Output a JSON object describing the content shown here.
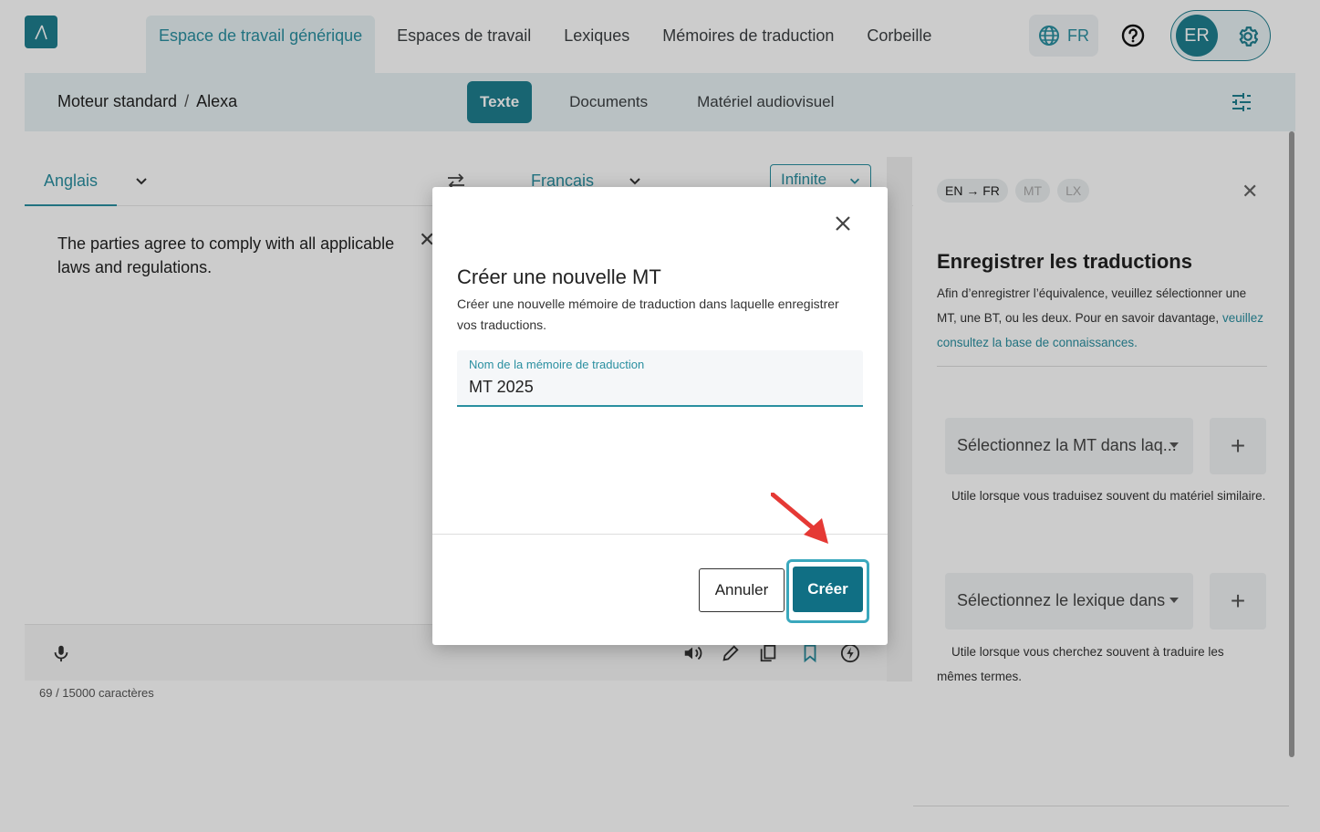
{
  "nav": {
    "items": [
      {
        "label": "Espace de travail générique",
        "active": true
      },
      {
        "label": "Espaces de travail"
      },
      {
        "label": "Lexiques"
      },
      {
        "label": "Mémoires de traduction"
      },
      {
        "label": "Corbeille"
      }
    ],
    "language": "FR",
    "user_initials": "ER"
  },
  "subbar": {
    "breadcrumb": [
      "Moteur standard",
      "Alexa"
    ],
    "modes": [
      {
        "label": "Texte",
        "active": true
      },
      {
        "label": "Documents"
      },
      {
        "label": "Matériel audiovisuel"
      }
    ]
  },
  "editor": {
    "source_language": "Anglais",
    "target_language": "Francais",
    "engine": "Infinite",
    "source_text": "The parties agree to comply with all applicable laws and regulations.",
    "char_count": "69 / 15000 caractères"
  },
  "panel": {
    "chips": [
      {
        "label": "EN → FR",
        "active": true
      },
      {
        "label": "MT"
      },
      {
        "label": "LX"
      }
    ],
    "title": "Enregistrer les traductions",
    "description": "Afin d’enregistrer l’équivalence, veuillez sélectionner une MT, une BT, ou les deux. Pour en savoir davantage, ",
    "description_link": "veuillez consultez la base de connaissances.",
    "tm_select_placeholder": "Sélectionnez la MT dans laq...",
    "tm_hint": "Utile lorsque vous traduisez souvent du matériel similaire.",
    "lex_select_placeholder": "Sélectionnez le lexique dans",
    "lex_hint": "Utile lorsque vous cherchez souvent à traduire les mêmes termes.",
    "plus_label": "+"
  },
  "modal": {
    "title": "Créer une nouvelle MT",
    "description": "Créer une nouvelle mémoire de traduction dans laquelle enregistrer vos traductions.",
    "field_label": "Nom de la mémoire de traduction",
    "field_value": "MT 2025",
    "cancel_label": "Annuler",
    "create_label": "Créer"
  },
  "colors": {
    "accent": "#1f7f8f",
    "accent_light": "#e8f2f4",
    "annotation_arrow": "#e53935"
  }
}
